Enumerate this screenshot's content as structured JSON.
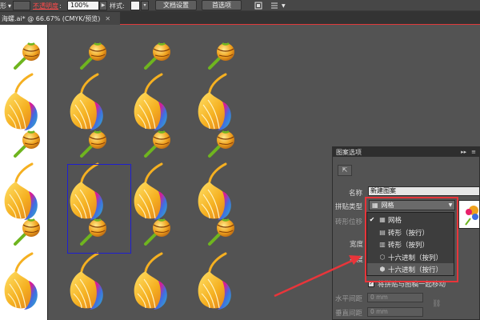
{
  "control_bar": {
    "shape_label": "形",
    "opacity_label": "不透明度",
    "opacity_value": "100%",
    "style_label": "样式",
    "doc_setup_button": "文档设置",
    "preferences_button": "首选项"
  },
  "document_tab": {
    "title": "海螺.ai* @ 66.67% (CMYK/预览)",
    "close": "✕"
  },
  "panel": {
    "title": "图案选项",
    "name_label": "名称",
    "name_value": "新建图案",
    "tile_type_label": "拼贴类型",
    "tile_type_value": "网格",
    "brick_offset_label": "砖形位移",
    "width_label": "宽度",
    "height_label": "高度",
    "move_tile_label": "将拼贴与图稿一起移动",
    "h_spacing_label": "水平间距",
    "h_spacing_value": "0 mm",
    "v_spacing_label": "垂直间距",
    "v_spacing_value": "0 mm",
    "dropdown": {
      "items": [
        {
          "label": "网格",
          "icon": "grid-icon",
          "checked": true
        },
        {
          "label": "砖形（按行）",
          "icon": "brick-row-icon",
          "checked": false
        },
        {
          "label": "砖形（按列）",
          "icon": "brick-column-icon",
          "checked": false
        },
        {
          "label": "十六进制（按列）",
          "icon": "hex-column-icon",
          "checked": false
        },
        {
          "label": "十六进制（按行）",
          "icon": "hex-row-icon",
          "checked": false
        }
      ]
    }
  },
  "colors": {
    "annotation_red": "#e8353a",
    "swatch_outline_blue": "#1f1fd0",
    "canvas_gray": "#535353"
  }
}
